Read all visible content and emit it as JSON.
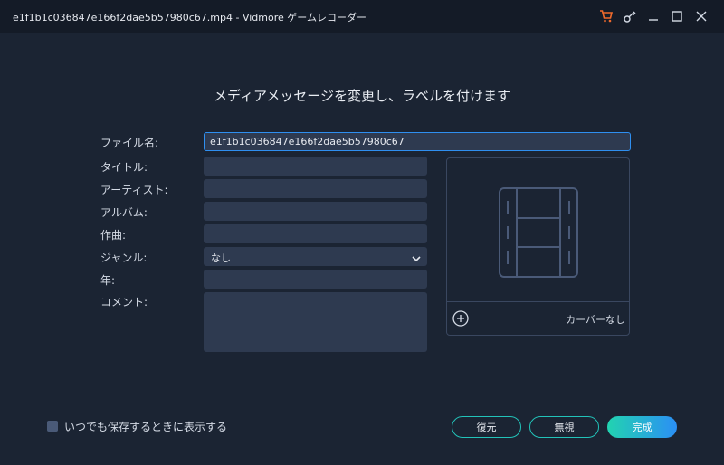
{
  "window": {
    "title": "e1f1b1c036847e166f2dae5b57980c67.mp4  -  Vidmore ゲームレコーダー",
    "icons": [
      "cart-icon",
      "key-icon",
      "minimize-icon",
      "maximize-icon",
      "close-icon"
    ]
  },
  "heading": "メディアメッセージを変更し、ラベルを付けます",
  "form": {
    "filename_label": "ファイル名:",
    "filename_value": "e1f1b1c036847e166f2dae5b57980c67",
    "title_label": "タイトル:",
    "artist_label": "アーティスト:",
    "album_label": "アルバム:",
    "composer_label": "作曲:",
    "genre_label": "ジャンル:",
    "genre_value": "なし",
    "year_label": "年:",
    "comment_label": "コメント:"
  },
  "cover": {
    "label": "カーバーなし",
    "icons": [
      "film-icon",
      "add-circle-icon"
    ]
  },
  "footer": {
    "checkbox_label": "いつでも保存するときに表示する",
    "checkbox_checked": false,
    "restore_label": "復元",
    "ignore_label": "無視",
    "done_label": "完成"
  },
  "colors": {
    "background": "#1b2433",
    "titlebar": "#141b27",
    "input": "#2e3a50",
    "accent_teal": "#22c3b9",
    "accent_blue": "#2b8ff5",
    "cart_orange": "#f06a2c"
  }
}
